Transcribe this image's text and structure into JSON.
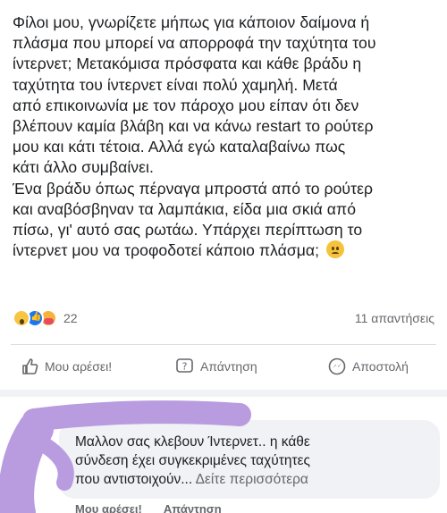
{
  "post": {
    "lines": [
      "Φίλοι μου, γνωρίζετε μήπως για κάποιον δαίμονα ή",
      "πλάσμα που μπορεί να απορροφά την ταχύτητα του",
      "ίντερνετ; Μετακόμισα πρόσφατα και κάθε βράδυ η",
      "ταχύτητα του ίντερνετ είναι πολύ χαμηλή. Μετά",
      "από επικοινωνία με τον πάροχο μου είπαν ότι δεν",
      "βλέπουν καμία βλάβη και να κάνω restart το ρούτερ",
      "μου και κάτι τέτοια. Αλλά εγώ καταλαβαίνω πως",
      "κάτι άλλο συμβαίνει.",
      "Ένα βράδυ όπως πέρναγα μπροστά από το ρούτερ",
      "και αναβόσβηναν τα λαμπάκια, είδα μια σκιά από",
      "πίσω, γι' αυτό σας ρωτάω. Υπάρχει περίπτωση το",
      "ίντερνετ μου να τροφοδοτεί κάποιο πλάσμα;"
    ],
    "trailing_emoji": "worried-face-icon"
  },
  "stats": {
    "reaction_count": "22",
    "comments_label": "11 απαντήσεις"
  },
  "actions": {
    "like": "Μου αρέσει!",
    "reply": "Απάντηση",
    "send": "Αποστολή"
  },
  "comment": {
    "lines": [
      "Μαλλον σας κλεβουν Ίντερνετ.. η κάθε",
      "σύνδεση έχει συγκεκριμένες ταχύτητες",
      "που αντιστοιχούν..."
    ],
    "see_more": "Δείτε περισσότερα",
    "like": "Μου αρέσει!",
    "reply": "Απάντηση"
  },
  "colors": {
    "scribble": "#b99be0",
    "accent": "#1877f2"
  }
}
